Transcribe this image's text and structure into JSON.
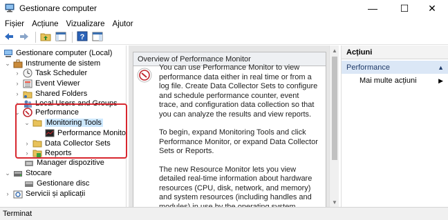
{
  "window": {
    "title": "Gestionare computer",
    "minimize": "—",
    "maximize": "☐",
    "close": "✕"
  },
  "menu": [
    {
      "label": "Fișier"
    },
    {
      "label": "Acțiune"
    },
    {
      "label": "Vizualizare"
    },
    {
      "label": "Ajutor"
    }
  ],
  "tree": {
    "root": "Gestionare computer (Local)",
    "system_tools": "Instrumente de sistem",
    "task_scheduler": "Task Scheduler",
    "event_viewer": "Event Viewer",
    "shared_folders": "Shared Folders",
    "local_users": "Local Users and Groups",
    "performance": "Performance",
    "monitoring_tools": "Monitoring Tools",
    "performance_monitor": "Performance Monitor",
    "data_collector_sets": "Data Collector Sets",
    "reports": "Reports",
    "device_manager": "Manager dispozitive",
    "storage": "Stocare",
    "disk_management": "Gestionare disc",
    "services": "Servicii și aplicații"
  },
  "center": {
    "header": "Overview of Performance Monitor",
    "paragraphs": [
      "You can use Performance Monitor to view performance data either in real time or from a log file. Create Data Collector Sets to configure and schedule performance counter, event trace, and configuration data collection so that you can analyze the results and view reports.",
      "To begin, expand Monitoring Tools and click Performance Monitor, or expand Data Collector Sets or Reports.",
      "The new Resource Monitor lets you view detailed real-time information about hardware resources (CPU, disk, network, and memory) and system resources (including handles and modules) in use by the operating system, services, and running"
    ]
  },
  "actions": {
    "header": "Acțiuni",
    "section": "Performance",
    "more": "Mai multe acțiuni"
  },
  "status": {
    "text": "Terminat"
  },
  "colors": {
    "highlight_border": "#d7262e",
    "selected_bg": "#cce8ff",
    "action_section_bg": "#dbe7f6"
  }
}
